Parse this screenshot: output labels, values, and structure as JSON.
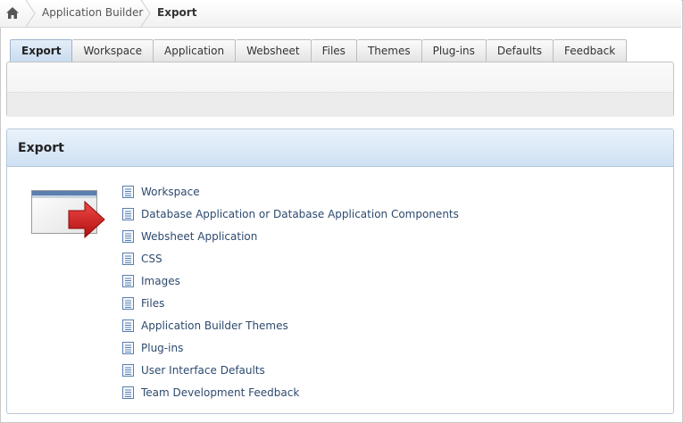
{
  "breadcrumb": {
    "home_icon": "home-icon",
    "items": [
      {
        "label": "Application Builder"
      },
      {
        "label": "Export"
      }
    ]
  },
  "tabs": [
    {
      "label": "Export",
      "active": true
    },
    {
      "label": "Workspace"
    },
    {
      "label": "Application"
    },
    {
      "label": "Websheet"
    },
    {
      "label": "Files"
    },
    {
      "label": "Themes"
    },
    {
      "label": "Plug-ins"
    },
    {
      "label": "Defaults"
    },
    {
      "label": "Feedback"
    }
  ],
  "region": {
    "title": "Export",
    "illustration_icon": "export-arrow-icon",
    "links": [
      {
        "label": "Workspace",
        "icon": "document-icon"
      },
      {
        "label": "Database Application or Database Application Components",
        "icon": "document-icon"
      },
      {
        "label": "Websheet Application",
        "icon": "document-icon"
      },
      {
        "label": "CSS",
        "icon": "document-icon"
      },
      {
        "label": "Images",
        "icon": "document-icon"
      },
      {
        "label": "Files",
        "icon": "document-icon"
      },
      {
        "label": "Application Builder Themes",
        "icon": "document-icon"
      },
      {
        "label": "Plug-ins",
        "icon": "document-icon"
      },
      {
        "label": "User Interface Defaults",
        "icon": "document-icon"
      },
      {
        "label": "Team Development Feedback",
        "icon": "document-icon"
      }
    ]
  },
  "colors": {
    "link": "#2d4a6e",
    "region_header": "#cfe1f3",
    "active_tab": "#c9dcf0",
    "arrow": "#d21f1f"
  }
}
